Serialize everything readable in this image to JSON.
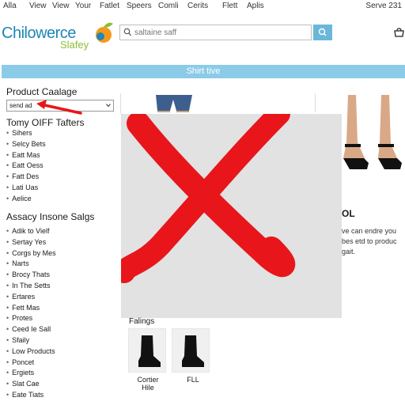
{
  "top_nav": {
    "items": [
      "Alla",
      "View",
      "View",
      "Your",
      "Fatlet",
      "Speers",
      "Comli",
      "Cerits",
      "Flett",
      "Aplis"
    ],
    "right": "Serve 231"
  },
  "header": {
    "logo_line1": "Chilowerce",
    "logo_line2": "Slafey",
    "search_placeholder": "saltaine saff"
  },
  "banner": {
    "label": "Shirt tive"
  },
  "sidebar": {
    "catalog_title": "Product Caalage",
    "catalog_select_value": "send ad",
    "section1": {
      "heading": "Tomy OIFF Tafters",
      "items": [
        "Sihers",
        "Selcy Bets",
        "Eatt Mas",
        "Eatt Oess",
        "Fatt Des",
        "Lati Uas",
        "Aelice"
      ]
    },
    "section2": {
      "heading": "Assacy Insone Salgs",
      "items": [
        "Adik to Vielf",
        "Sertay Yes",
        "Corgs by Mes",
        "Narts",
        "Brocy Thats",
        "In The Setts",
        "Ertares",
        "Fett Mas",
        "Protes",
        "Ceed Ie Sall",
        "Sfaily",
        "Low Products",
        "Poncet",
        "Ergiets",
        "Slat Cae",
        "Eate Tiats"
      ]
    }
  },
  "main": {
    "promo_title": "OL",
    "promo_lines": [
      "ve can endre you",
      "bes etd to produc",
      "gait."
    ],
    "ratings_label": "Falings",
    "thumbs": [
      {
        "label_line1": "Cortier",
        "label_line2": "Hile"
      },
      {
        "label_line1": "FLL"
      }
    ]
  },
  "icons": {
    "search": "search-icon",
    "cart": "cart-icon",
    "chevron": "chevron-down-icon"
  },
  "colors": {
    "brand_blue": "#1f86b7",
    "brand_green": "#8bbf34",
    "banner": "#8ccbe8",
    "search_button": "#6cb7d9",
    "error_red": "#e8161b"
  }
}
